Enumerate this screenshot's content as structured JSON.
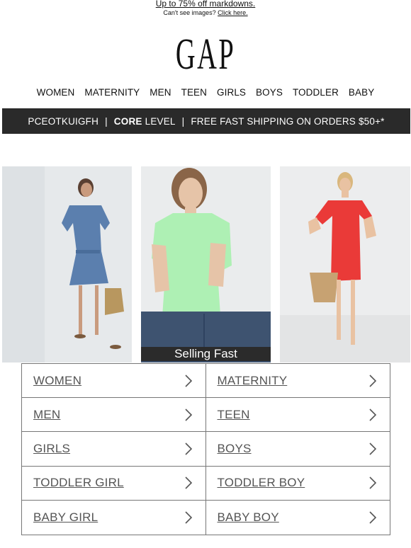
{
  "preheader": {
    "promo": "Up to 75% off markdowns.",
    "images_text": "Can't see images?",
    "images_link": "Click here."
  },
  "logo": {
    "text": "GAP"
  },
  "nav": {
    "items": [
      "WOMEN",
      "MATERNITY",
      "MEN",
      "TEEN",
      "GIRLS",
      "BOYS",
      "TODDLER",
      "BABY"
    ]
  },
  "banner": {
    "code": "PCEOTKUIGFH",
    "level_bold": "CORE",
    "level_rest": "LEVEL",
    "shipping": "FREE FAST SHIPPING ON ORDERS $50+*"
  },
  "photos": {
    "badge": "Selling Fast",
    "colors": {
      "denim_dress": "#5b7fae",
      "green_tee": "#aef0b4",
      "red_dress": "#ea3a38",
      "jeans": "#3e5370"
    }
  },
  "categories": [
    {
      "label": "WOMEN",
      "icon": "chevron-right-icon"
    },
    {
      "label": "MATERNITY",
      "icon": "chevron-right-icon"
    },
    {
      "label": "MEN",
      "icon": "chevron-right-icon"
    },
    {
      "label": "TEEN",
      "icon": "chevron-right-icon"
    },
    {
      "label": "GIRLS",
      "icon": "chevron-right-icon"
    },
    {
      "label": "BOYS",
      "icon": "chevron-right-icon"
    },
    {
      "label": "TODDLER GIRL",
      "icon": "chevron-right-icon"
    },
    {
      "label": "TODDLER BOY",
      "icon": "chevron-right-icon"
    },
    {
      "label": "BABY GIRL",
      "icon": "chevron-right-icon"
    },
    {
      "label": "BABY BOY",
      "icon": "chevron-right-icon"
    }
  ]
}
